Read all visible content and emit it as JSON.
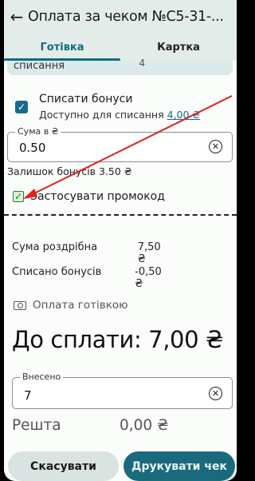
{
  "header": {
    "back_icon": "arrow-left-icon",
    "title": "Оплата за чеком №С5-31-..."
  },
  "tabs": [
    {
      "label": "Готівка",
      "active": true
    },
    {
      "label": "Картка",
      "active": false
    }
  ],
  "top_card": {
    "partial_text": "списання",
    "partial_value": "4"
  },
  "bonus_checkbox": {
    "checked": true,
    "label": "Списати бонуси",
    "available_label": "Доступно для списання",
    "available_value": "4,00 ₴"
  },
  "amount_field": {
    "label": "Сума в ₴",
    "value": "0.50"
  },
  "bonus_left": "Залишок бонусів  3.50 ₴",
  "promo": {
    "checked": true,
    "label": "Застосувати промокод"
  },
  "summary": [
    {
      "label": "Сума роздрібна",
      "value": "7,50 ₴"
    },
    {
      "label": "Списано бонусів",
      "value": "-0,50 ₴"
    }
  ],
  "cash_section": {
    "icon": "cash-icon",
    "title": "Оплата готівкою"
  },
  "total": "До сплати: 7,00 ₴",
  "deposited_field": {
    "label": "Внесено",
    "value": "7"
  },
  "change": {
    "label": "Решта",
    "value": "0,00 ₴"
  },
  "buttons": {
    "cancel": "Скасувати",
    "print": "Друкувати чек"
  },
  "colors": {
    "accent": "#1a6a7e",
    "annotation_arrow": "#e02020"
  }
}
